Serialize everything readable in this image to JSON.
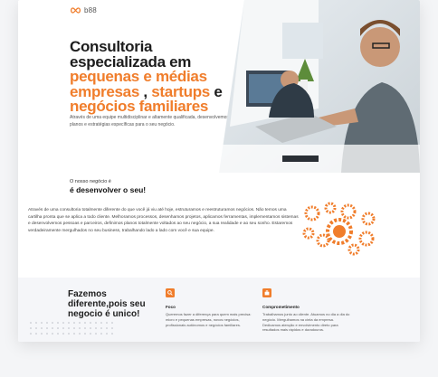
{
  "brand": {
    "name": "b88",
    "accent": "#f07d2b"
  },
  "hero": {
    "title_line1": "Consultoria",
    "title_line2": "especializada em",
    "title_orange1": "pequenas e médias",
    "title_orange2": "empresas",
    "title_comma": " , ",
    "title_orange3": "startups",
    "title_e": " e",
    "title_orange4": "negócios familiares",
    "description": "Através de uma equipe multidisciplinar e altamente qualificada, desenvolvemos planos e estratégias específicas para o seu negócio."
  },
  "about": {
    "kicker": "O nosso negócio é",
    "title": "é desenvolver o seu!",
    "body": "Através de uma consultoria totalmente diferente do que você já viu até hoje, estruturamos e reestruturamos negócios. Não temos uma cartilha pronta que se aplica a todo cliente. Melhoramos processos, desenhamos projetos, aplicamos ferramentas, implementamos sistemas e desenvolvemos pessoas e parceiros, definimos planos totalmente voltados ao seu negócio, a sua realidade e ao seu sonho. Estaremos verdadeiramente mergulhados no seu business, trabalhando lado a lado com você e sua equipe."
  },
  "diff": {
    "title": "Fazemos diferente,pois seu negocio é unico!",
    "features": [
      {
        "icon": "search-icon",
        "title": "Foco",
        "text": "Queremos fazer a diferença para quem mais precisa: micro e pequenas empresas, novos negócios, profissionais autônomos e negócios familiares."
      },
      {
        "icon": "briefcase-icon",
        "title": "Comprometimento",
        "text": "Trabalhamos junto ao cliente. Atuamos no dia a dia do negócio. Mergulhamos na cinta da empresa. Dedicamos atenção e envolvimento direto para resultados mais rápidos e duradouros."
      }
    ]
  }
}
